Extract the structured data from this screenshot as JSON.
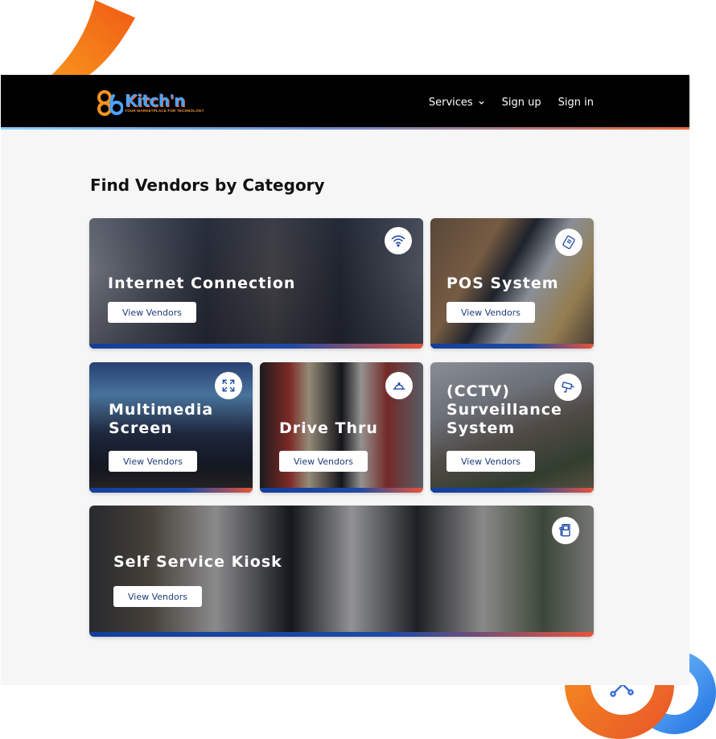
{
  "brand": {
    "name": "Kitch'n",
    "mark": "86",
    "tagline": "YOUR MARKETPLACE FOR TECHNOLOGY"
  },
  "nav": {
    "services": "Services",
    "signup": "Sign up",
    "signin": "Sign in"
  },
  "page": {
    "heading": "Find Vendors by Category"
  },
  "categories": [
    {
      "title": "Internet Connection",
      "button": "View Vendors",
      "icon": "wifi-icon"
    },
    {
      "title": "POS System",
      "button": "View Vendors",
      "icon": "card-reader-icon"
    },
    {
      "title": "Multimedia Screen",
      "button": "View Vendors",
      "icon": "expand-icon"
    },
    {
      "title": "Drive Thru",
      "button": "View Vendors",
      "icon": "cloche-icon"
    },
    {
      "title": "(CCTV) Surveillance System",
      "button": "View Vendors",
      "icon": "cctv-camera-icon"
    },
    {
      "title": "Self Service Kiosk",
      "button": "View Vendors",
      "icon": "kiosk-icon"
    }
  ],
  "colors": {
    "navbar": "#000000",
    "accent_blue": "#143f9a",
    "accent_orange": "#f36b3d",
    "brand_blue": "#4aa3ff"
  }
}
